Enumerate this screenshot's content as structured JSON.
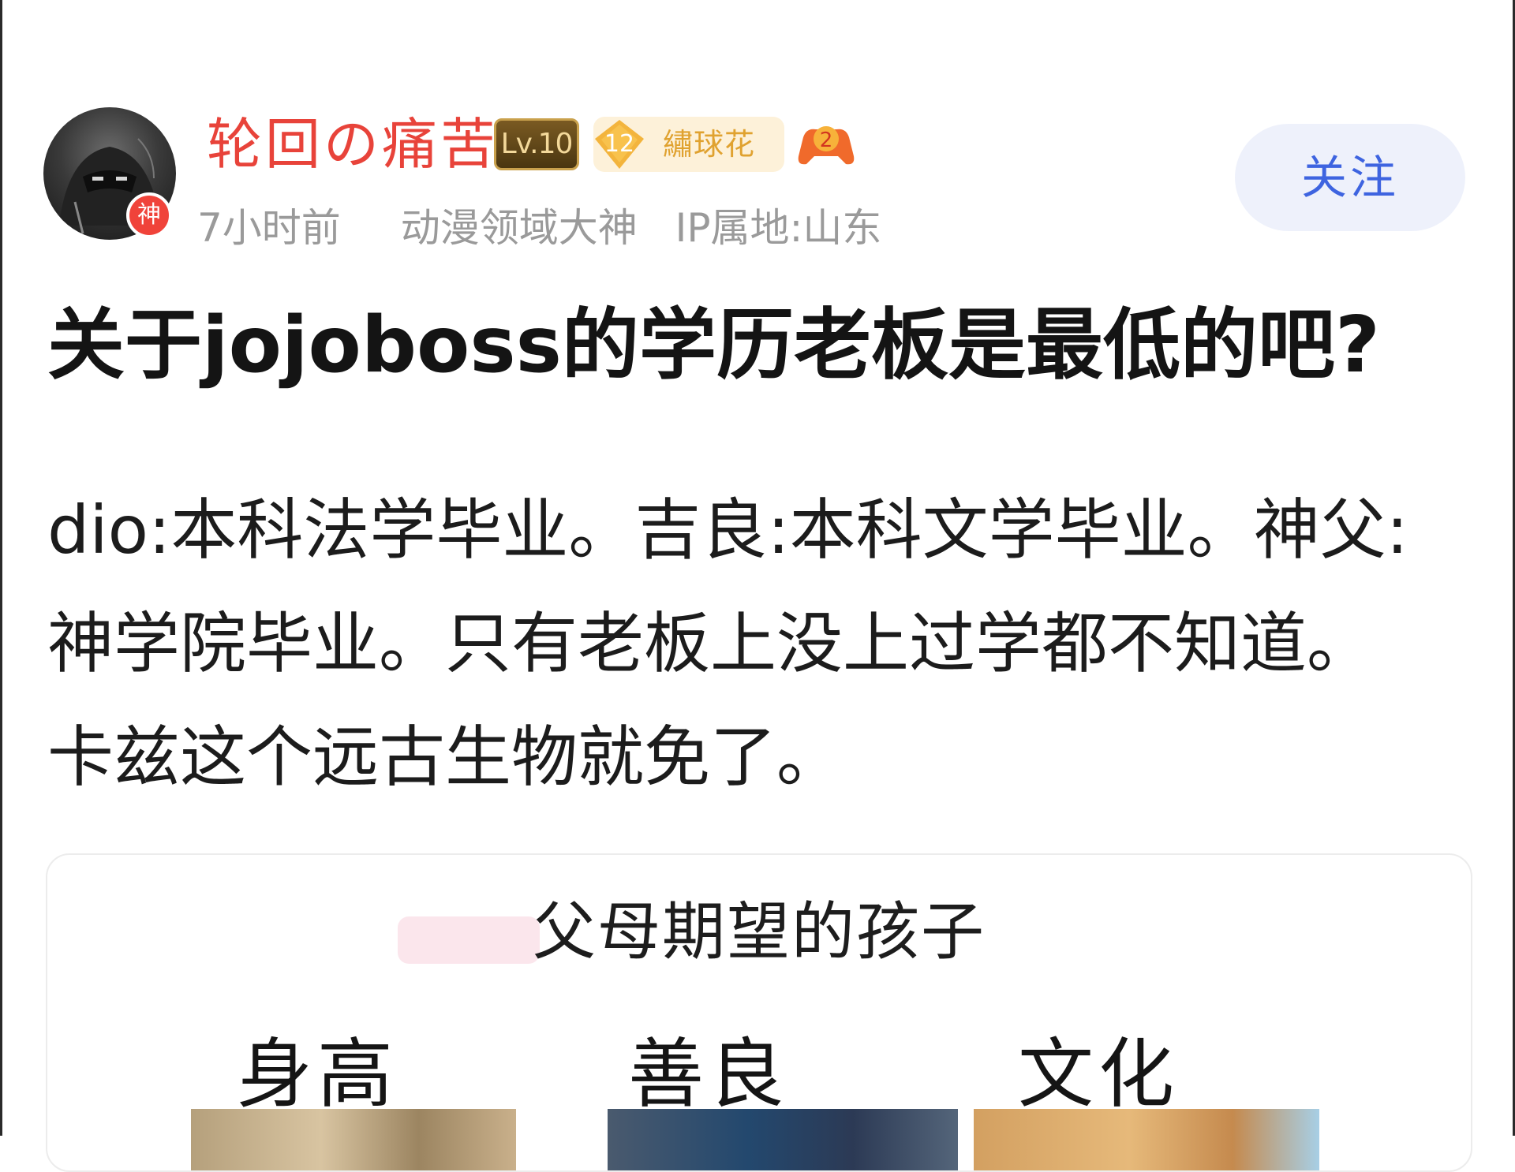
{
  "user": {
    "name": "轮回の痛苦",
    "avatar_badge": "神",
    "level": "Lv.10",
    "fan_badge_level": "12",
    "fan_badge_name": "繡球花",
    "game_badge_level": "2"
  },
  "meta": {
    "time": "7小时前",
    "title": "动漫领域大神",
    "ip": "IP属地:山东"
  },
  "follow_label": "关注",
  "post": {
    "title": "关于jojoboss的学历老板是最低的吧?",
    "body_lines": [
      "dio:本科法学毕业。吉良:本科文学毕业。神父:",
      "神学院毕业。只有老板上没上过学都不知道。",
      "卡兹这个远古生物就免了。"
    ]
  },
  "image": {
    "title": "父母期望的孩子",
    "columns": [
      "身高",
      "善良",
      "文化"
    ]
  },
  "colors": {
    "username": "#e8433a",
    "follow_text": "#3e64e0",
    "follow_bg": "#eef1fb",
    "meta_text": "#9a9a9a"
  }
}
